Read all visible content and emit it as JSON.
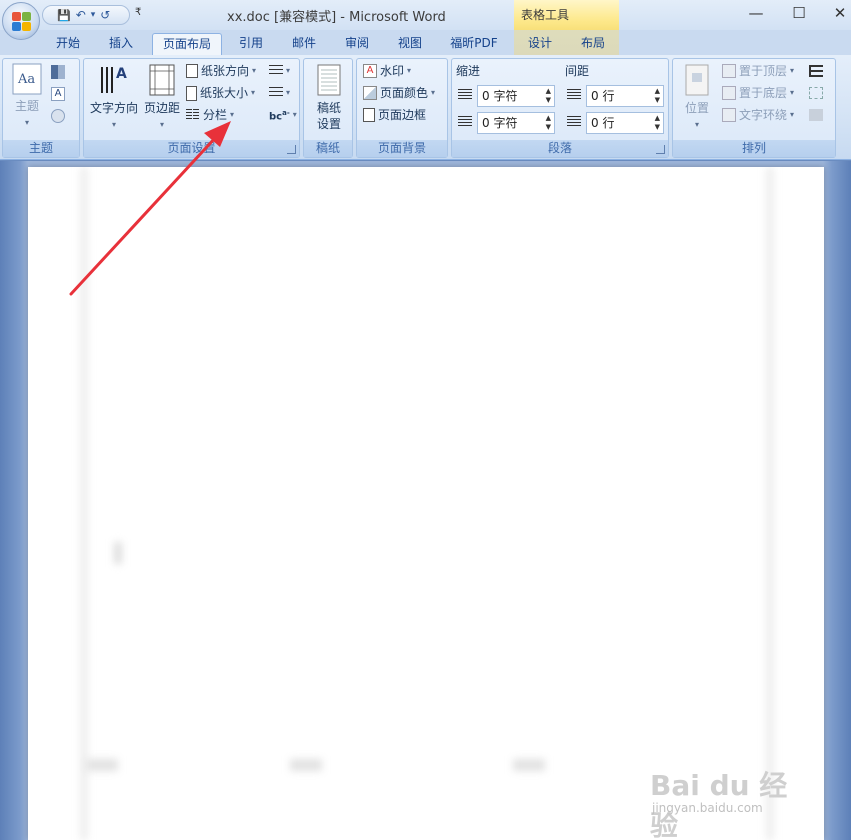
{
  "window": {
    "title": "xx.doc [兼容模式] - Microsoft Word",
    "context_tab_title": "表格工具",
    "controls": {
      "minimize": "—",
      "maximize": "☐",
      "close": "✕"
    }
  },
  "qat": {
    "save": "💾",
    "undo": "↶",
    "undo_more": "▾",
    "redo": "↺",
    "more": "₹"
  },
  "tabs": [
    {
      "label": "开始"
    },
    {
      "label": "插入"
    },
    {
      "label": "页面布局"
    },
    {
      "label": "引用"
    },
    {
      "label": "邮件"
    },
    {
      "label": "审阅"
    },
    {
      "label": "视图"
    },
    {
      "label": "福昕PDF"
    },
    {
      "label": "设计"
    },
    {
      "label": "布局"
    }
  ],
  "ribbon": {
    "themes": {
      "theme_label": "主题",
      "group_label": "主题"
    },
    "page_setup": {
      "text_direction": "文字方向",
      "margins": "页边距",
      "orientation": "纸张方向",
      "size": "纸张大小",
      "columns": "分栏",
      "group_label": "页面设置"
    },
    "manuscript": {
      "manuscript_setup_line1": "稿纸",
      "manuscript_setup_line2": "设置",
      "group_label": "稿纸"
    },
    "page_background": {
      "watermark": "水印",
      "page_color": "页面颜色",
      "page_borders": "页面边框",
      "group_label": "页面背景"
    },
    "paragraph": {
      "indent_label": "缩进",
      "spacing_label": "间距",
      "indent_left": "0 字符",
      "indent_right": "0 字符",
      "spacing_before": "0 行",
      "spacing_after": "0 行",
      "group_label": "段落"
    },
    "arrange": {
      "position": "位置",
      "bring_front": "置于顶层",
      "send_back": "置于底层",
      "text_wrap": "文字环绕",
      "group_label": "排列"
    }
  },
  "watermark": {
    "brand": "Bai du 经验",
    "url": "jingyan.baidu.com"
  },
  "colors": {
    "annotation_arrow": "#e8313a",
    "ribbon_bg": "#dbe8f8",
    "context_tab": "#fde88a"
  }
}
